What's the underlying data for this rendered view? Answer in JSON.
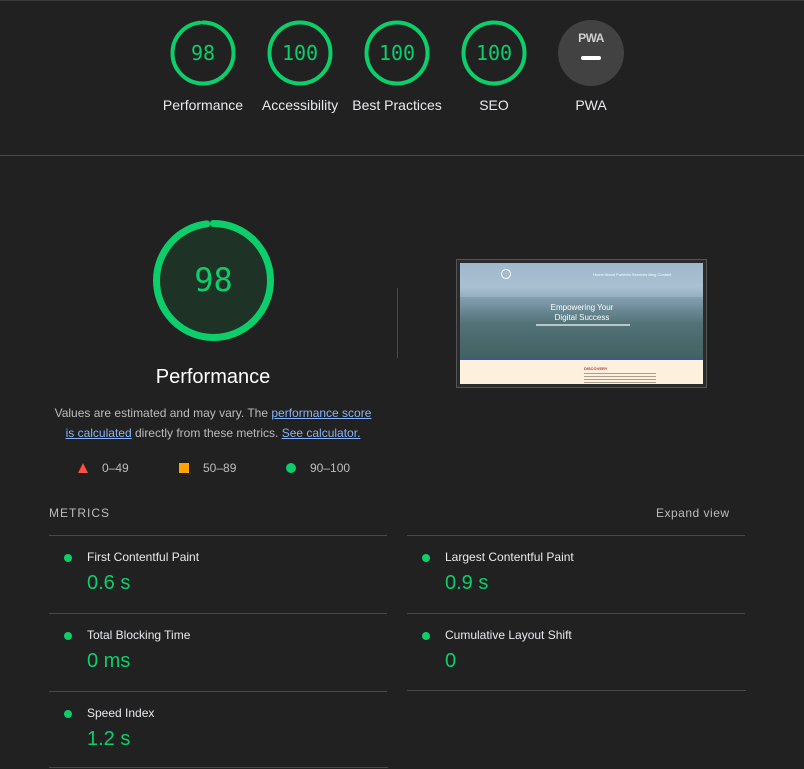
{
  "categories": [
    {
      "label": "Performance",
      "score": "98",
      "value": 98
    },
    {
      "label": "Accessibility",
      "score": "100",
      "value": 100
    },
    {
      "label": "Best Practices",
      "score": "100",
      "value": 100
    },
    {
      "label": "SEO",
      "score": "100",
      "value": 100
    },
    {
      "label": "PWA",
      "badge_text": "PWA"
    }
  ],
  "performance": {
    "score": "98",
    "value": 98,
    "title": "Performance",
    "desc_prefix": "Values are estimated and may vary. The ",
    "desc_link1": "performance score is calculated",
    "desc_middle": " directly from these metrics. ",
    "desc_link2": "See calculator."
  },
  "legend": {
    "fail": "0–49",
    "average": "50–89",
    "pass": "90–100"
  },
  "thumbnail": {
    "hero_title_line1": "Empowering Your",
    "hero_title_line2": "Digital Success",
    "section_label": "DISCOVERY",
    "nav_items": "Home  About  Portfolio  Services  Blog  Contact"
  },
  "metrics": {
    "heading": "METRICS",
    "expand_label": "Expand view",
    "items": [
      {
        "title": "First Contentful Paint",
        "value": "0.6 s"
      },
      {
        "title": "Largest Contentful Paint",
        "value": "0.9 s"
      },
      {
        "title": "Total Blocking Time",
        "value": "0 ms"
      },
      {
        "title": "Cumulative Layout Shift",
        "value": "0"
      },
      {
        "title": "Speed Index",
        "value": "1.2 s"
      }
    ]
  },
  "colors": {
    "pass": "#0cce6b",
    "average": "#ffa400",
    "fail": "#ff4e42",
    "background": "#212121",
    "link": "#8ab4f8"
  }
}
